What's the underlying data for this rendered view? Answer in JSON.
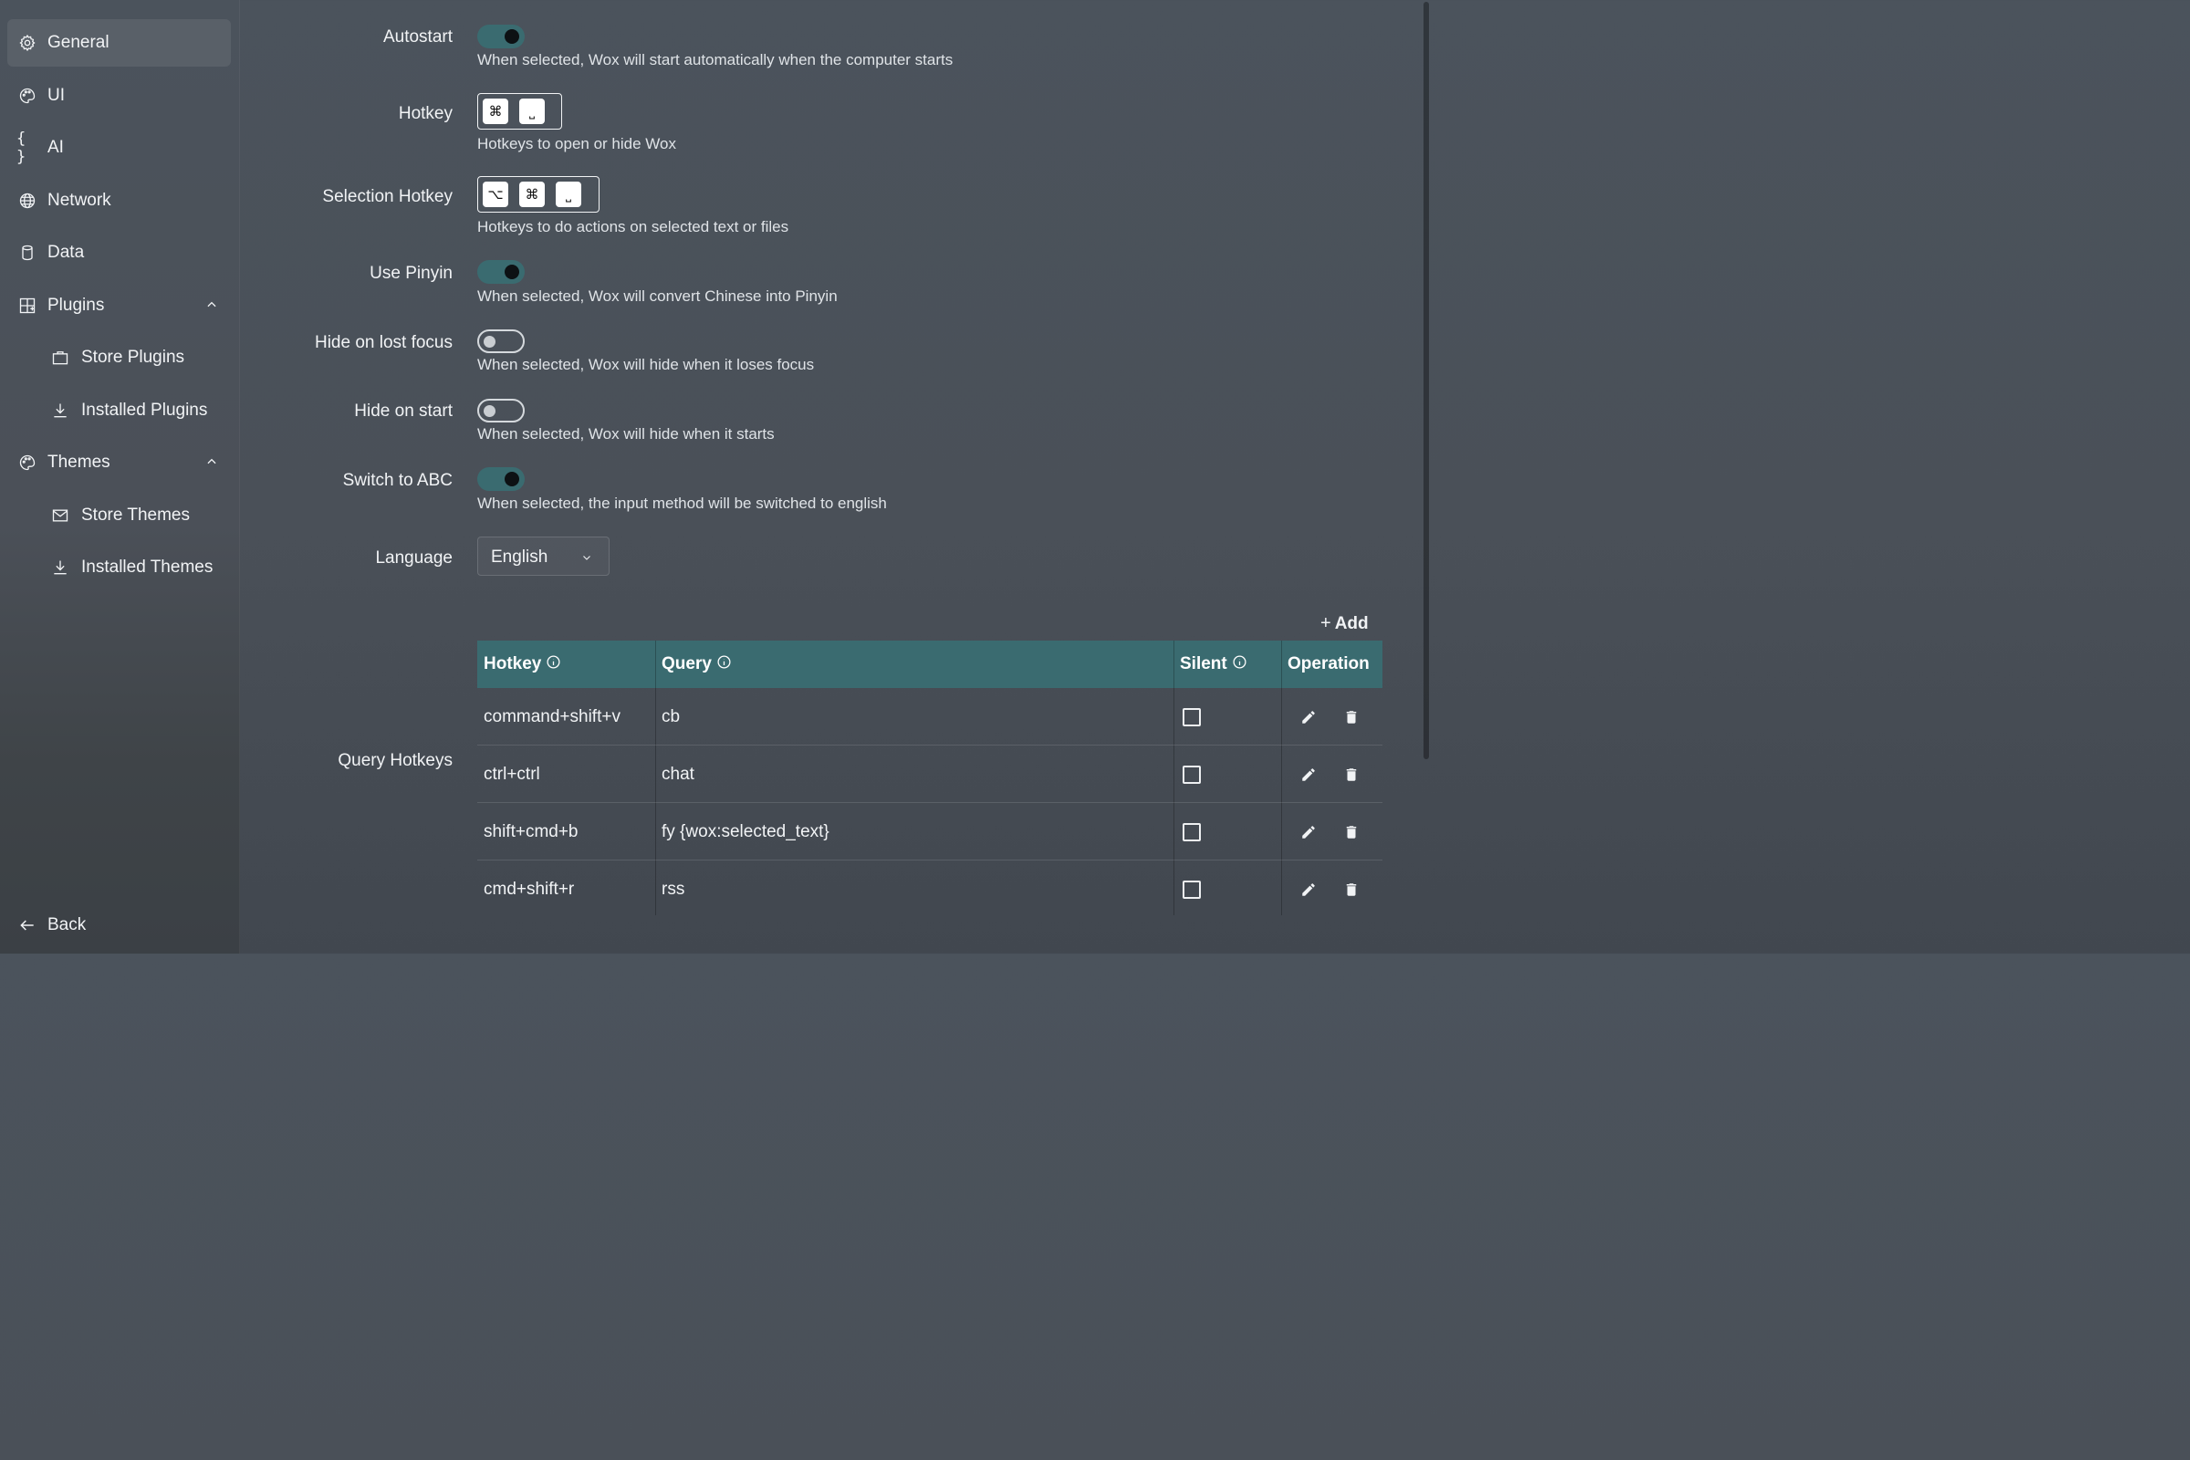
{
  "sidebar": {
    "items": [
      {
        "label": "General",
        "icon": "gear-icon",
        "active": true
      },
      {
        "label": "UI",
        "icon": "palette-icon"
      },
      {
        "label": "AI",
        "icon": "braces-icon"
      },
      {
        "label": "Network",
        "icon": "globe-icon"
      },
      {
        "label": "Data",
        "icon": "database-icon"
      },
      {
        "label": "Plugins",
        "icon": "plugins-grid-icon",
        "expanded": true
      },
      {
        "label": "Store Plugins",
        "icon": "shopping-bag-icon"
      },
      {
        "label": "Installed Plugins",
        "icon": "download-icon"
      },
      {
        "label": "Themes",
        "icon": "palette-icon",
        "expanded": true
      },
      {
        "label": "Store Themes",
        "icon": "envelope-icon"
      },
      {
        "label": "Installed Themes",
        "icon": "download-icon"
      }
    ],
    "back_label": "Back"
  },
  "settings": {
    "autostart": {
      "label": "Autostart",
      "value": true,
      "desc": "When selected, Wox will start automatically when the computer starts"
    },
    "hotkey": {
      "label": "Hotkey",
      "keys": [
        "⌘",
        "⎵"
      ],
      "desc": "Hotkeys to open or hide Wox"
    },
    "selection_hotkey": {
      "label": "Selection Hotkey",
      "keys": [
        "⌥",
        "⌘",
        "⎵"
      ],
      "desc": "Hotkeys to do actions on selected text or files"
    },
    "use_pinyin": {
      "label": "Use Pinyin",
      "value": true,
      "desc": "When selected, Wox will convert Chinese into Pinyin"
    },
    "hide_on_lost_focus": {
      "label": "Hide on lost focus",
      "value": false,
      "desc": "When selected, Wox will hide when it loses focus"
    },
    "hide_on_start": {
      "label": "Hide on start",
      "value": false,
      "desc": "When selected, Wox will hide when it starts"
    },
    "switch_to_abc": {
      "label": "Switch to ABC",
      "value": true,
      "desc": "When selected, the input method will be switched to english"
    },
    "language": {
      "label": "Language",
      "value": "English"
    }
  },
  "query_hotkeys": {
    "label": "Query Hotkeys",
    "add_label": "Add",
    "columns": {
      "hotkey": "Hotkey",
      "query": "Query",
      "silent": "Silent",
      "operation": "Operation"
    },
    "rows": [
      {
        "hotkey": "command+shift+v",
        "query": "cb",
        "silent": false
      },
      {
        "hotkey": "ctrl+ctrl",
        "query": "chat",
        "silent": false
      },
      {
        "hotkey": "shift+cmd+b",
        "query": "fy {wox:selected_text}",
        "silent": false
      },
      {
        "hotkey": "cmd+shift+r",
        "query": "rss",
        "silent": false
      }
    ]
  },
  "colors": {
    "accent": "#3a6b70",
    "knob_on": "#0d1114",
    "text": "#f1f3f5"
  }
}
